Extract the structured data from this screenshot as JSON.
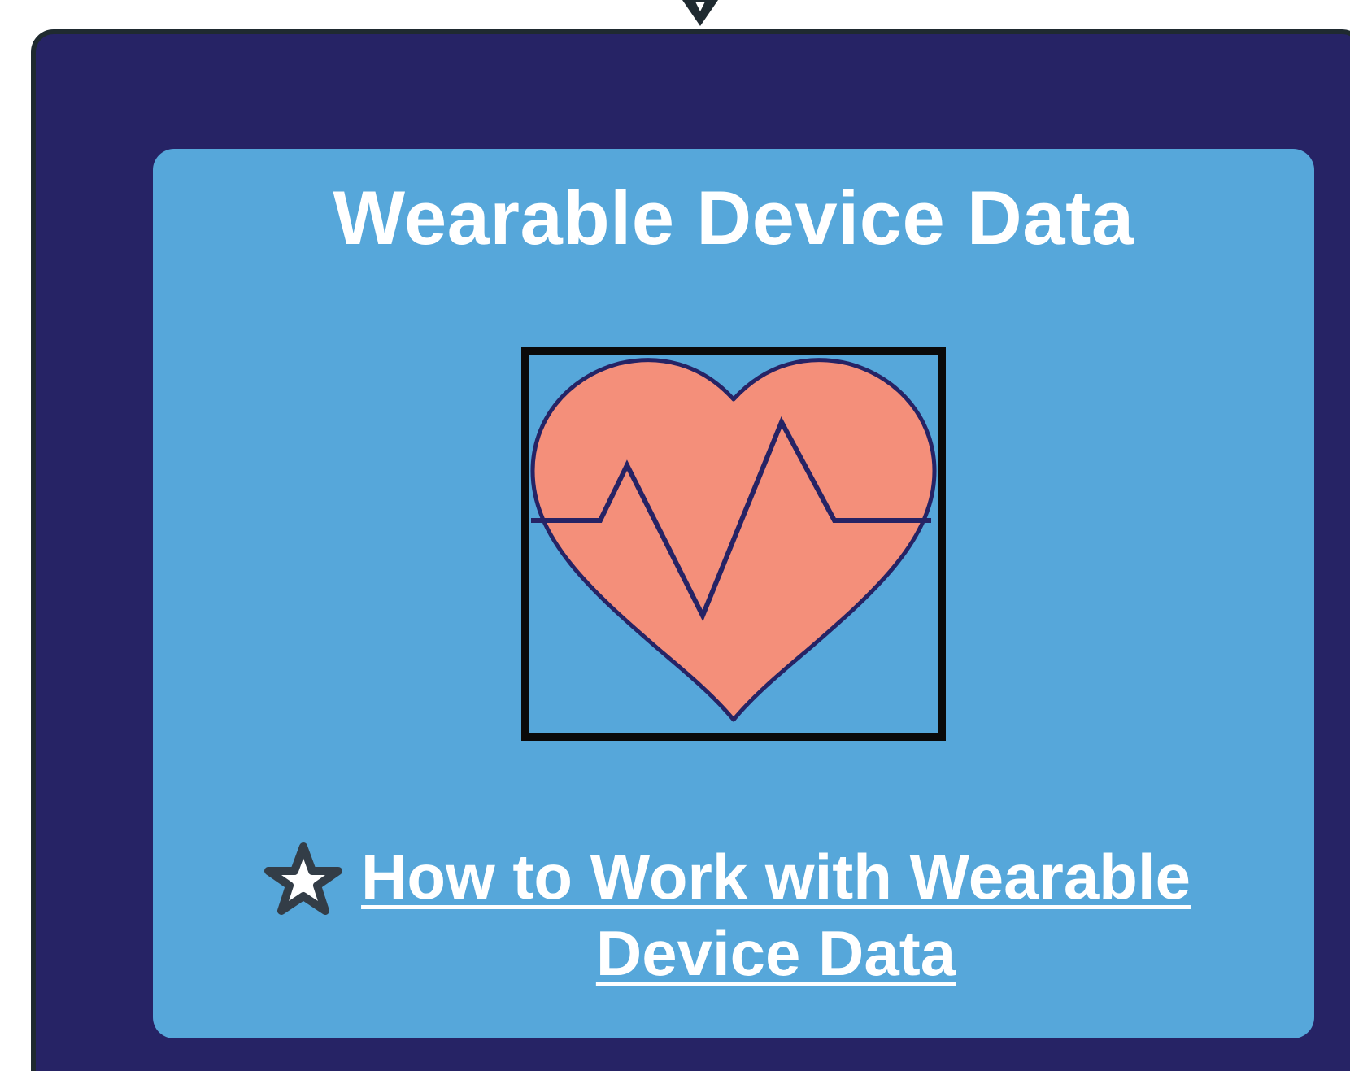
{
  "card": {
    "title": "Wearable Device Data",
    "link_label": "How to Work with Wearable Device Data"
  },
  "icons": {
    "main": "heart-pulse-icon",
    "link_marker": "star-icon",
    "connector": "arrow-down-icon"
  },
  "colors": {
    "outer_background": "#262365",
    "outer_border": "#1f2a30",
    "card_background": "#56a7da",
    "heart_fill": "#f48f7a",
    "heart_stroke": "#262365",
    "text": "#ffffff"
  }
}
